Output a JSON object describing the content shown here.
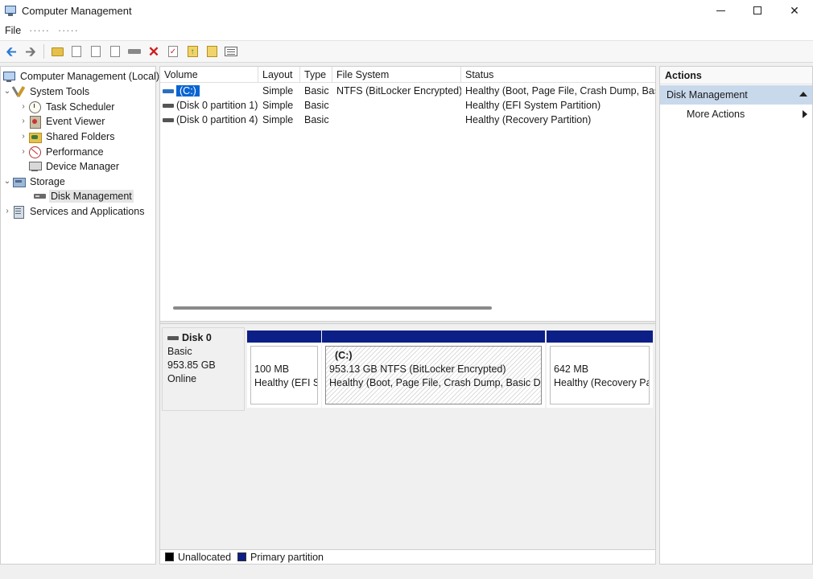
{
  "window": {
    "title": "Computer Management",
    "close_glyph": "✕"
  },
  "menu": {
    "items": [
      "File",
      "·····",
      "·····"
    ]
  },
  "toolbar": {
    "icons": [
      "back-arrow",
      "forward-arrow",
      "folder",
      "properties",
      "drive",
      "disconnect",
      "delete",
      "check",
      "up-folder",
      "search",
      "view"
    ]
  },
  "tree": {
    "root": "Computer Management (Local)",
    "items": [
      {
        "label": "System Tools"
      },
      {
        "label": "Task Scheduler"
      },
      {
        "label": "Event Viewer"
      },
      {
        "label": "Shared Folders"
      },
      {
        "label": "Performance"
      },
      {
        "label": "Device Manager"
      },
      {
        "label": "Storage"
      },
      {
        "label": "Disk Management"
      },
      {
        "label": "Services and Applications"
      }
    ]
  },
  "volumes": {
    "columns": [
      "Volume",
      "Layout",
      "Type",
      "File System",
      "Status"
    ],
    "rows": [
      {
        "volume": "(C:)",
        "layout": "Simple",
        "type": "Basic",
        "fs": "NTFS (BitLocker Encrypted)",
        "status": "Healthy (Boot, Page File, Crash Dump, Basi"
      },
      {
        "volume": "(Disk 0 partition 1)",
        "layout": "Simple",
        "type": "Basic",
        "fs": "",
        "status": "Healthy (EFI System Partition)"
      },
      {
        "volume": "(Disk 0 partition 4)",
        "layout": "Simple",
        "type": "Basic",
        "fs": "",
        "status": "Healthy (Recovery Partition)"
      }
    ]
  },
  "disk": {
    "name": "Disk 0",
    "type": "Basic",
    "size": "953.85 GB",
    "state": "Online",
    "partitions": [
      {
        "title": "",
        "line1": "100 MB",
        "line2": "Healthy (EFI Sy"
      },
      {
        "title": "(C:)",
        "line1": "953.13 GB NTFS (BitLocker Encrypted)",
        "line2": "Healthy (Boot, Page File, Crash Dump, Basic Dat"
      },
      {
        "title": "",
        "line1": "642 MB",
        "line2": "Healthy (Recovery Pa"
      }
    ]
  },
  "legend": {
    "unallocated": "Unallocated",
    "primary": "Primary partition",
    "unallocated_color": "#000000",
    "primary_color": "#0b1f86"
  },
  "actions": {
    "header": "Actions",
    "section": "Disk Management",
    "items": [
      "More Actions"
    ]
  },
  "colors": {
    "accent": "#0a64d2",
    "partition_bar": "#0b1f86",
    "actions_selected": "#c9d9ec"
  }
}
